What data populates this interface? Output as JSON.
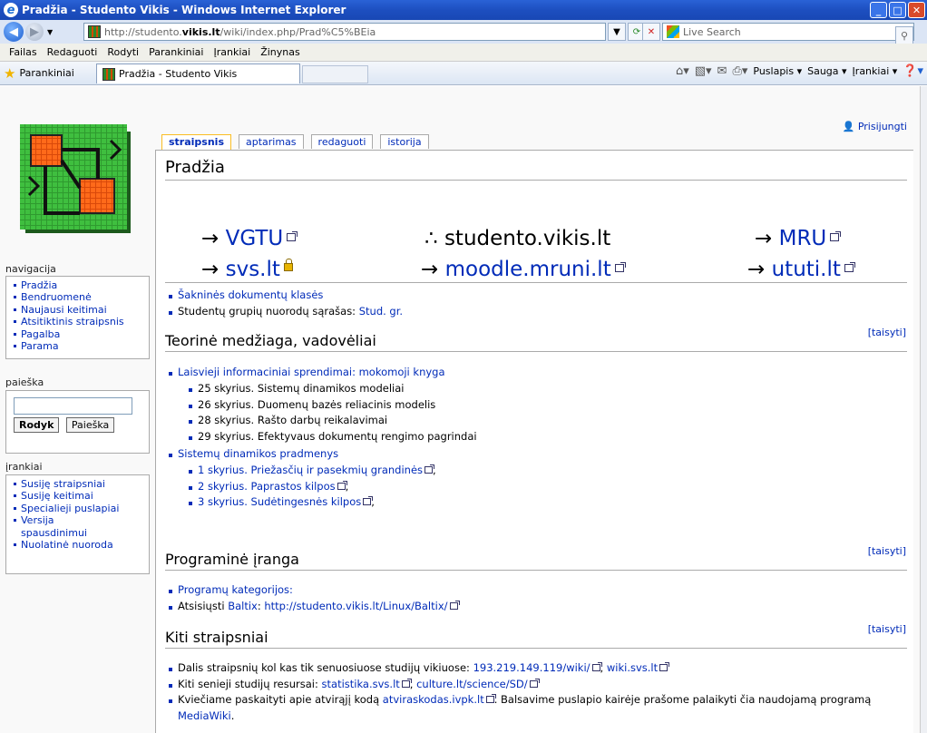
{
  "window": {
    "title": "Pradžia - Studento Vikis - Windows Internet Explorer"
  },
  "address": {
    "url_prefix": "http://studento.",
    "url_domain": "vikis.lt",
    "url_suffix": "/wiki/index.php/Prad%C5%BEia",
    "search_placeholder": "Live Search"
  },
  "menu": [
    "Failas",
    "Redaguoti",
    "Rodyti",
    "Parankiniai",
    "Įrankiai",
    "Žinynas"
  ],
  "favbar": {
    "favorites_label": "Parankiniai",
    "tab_title": "Pradžia - Studento Vikis",
    "commands": {
      "page": "Puslapis ▾",
      "safety": "Sauga ▾",
      "tools": "Įrankiai ▾"
    }
  },
  "user": {
    "login": "Prisijungti"
  },
  "sidebar": {
    "navigation_title": "navigacija",
    "navigation": [
      "Pradžia",
      "Bendruomenė",
      "Naujausi keitimai",
      "Atsitiktinis straipsnis",
      "Pagalba",
      "Parama"
    ],
    "search_title": "paieška",
    "search_go": "Rodyk",
    "search_search": "Paieška",
    "tools_title": "įrankiai",
    "tools": [
      "Susiję straipsniai",
      "Susiję keitimai",
      "Specialieji puslapiai",
      "Versija",
      "spausdinimui",
      "Nuolatinė nuoroda"
    ]
  },
  "tabs": [
    "straipsnis",
    "aptarimas",
    "redaguoti",
    "istorija"
  ],
  "page": {
    "title": "Pradžia",
    "big_links": {
      "vgtu": "VGTU",
      "center": "∴ studento.vikis.lt",
      "mru": "MRU",
      "svs": "svs.lt",
      "moodle": "moodle.mruni.lt",
      "ututi": "ututi.lt",
      "arrow": "→"
    },
    "intro_items": {
      "item1": "Šakninės dokumentų klasės",
      "item2_text": "Studentų grupių nuorodų sąrašas: ",
      "item2_link": "Stud. gr."
    },
    "edit_label": "[taisyti]",
    "section1": {
      "heading": "Teorinė medžiaga, vadovėliai",
      "book1": "Laisvieji informaciniai sprendimai: mokomoji knyga",
      "book1_items": [
        "25 skyrius. Sistemų dinamikos modeliai",
        "26 skyrius. Duomenų bazės reliacinis modelis",
        "28 skyrius. Rašto darbų reikalavimai",
        "29 skyrius. Efektyvaus dokumentų rengimo pagrindai"
      ],
      "book2": "Sistemų dinamikos pradmenys",
      "book2_items": [
        "1 skyrius. Priežasčių ir pasekmių grandinės",
        "2 skyrius. Paprastos kilpos",
        "3 skyrius. Sudėtingesnės kilpos"
      ]
    },
    "section2": {
      "heading": "Programinė įranga",
      "item1": "Programų kategorijos:",
      "item2_text": "Atsisiųsti ",
      "item2_link1": "Baltix",
      "item2_sep": ": ",
      "item2_link2": "http://studento.vikis.lt/Linux/Baltix/"
    },
    "section3": {
      "heading": "Kiti straipsniai",
      "item1_text": "Dalis straipsnių kol kas tik senuosiuose studijų vikiuose: ",
      "item1_link1": "193.219.149.119/wiki/",
      "item1_link2": "wiki.svs.lt",
      "item2_text": "Kiti senieji studijų resursai: ",
      "item2_link1": "statistika.svs.lt",
      "item2_link2": "culture.lt/science/SD/",
      "item3_text": "Kviečiame paskaityti apie atvirąjį kodą ",
      "item3_link": "atviraskodas.ivpk.lt",
      "item3_text2": ". Balsavime puslapio kairėje prašome palaikyti čia naudojamą programą",
      "item3_link2": "MediaWiki",
      "item3_end": "."
    }
  }
}
